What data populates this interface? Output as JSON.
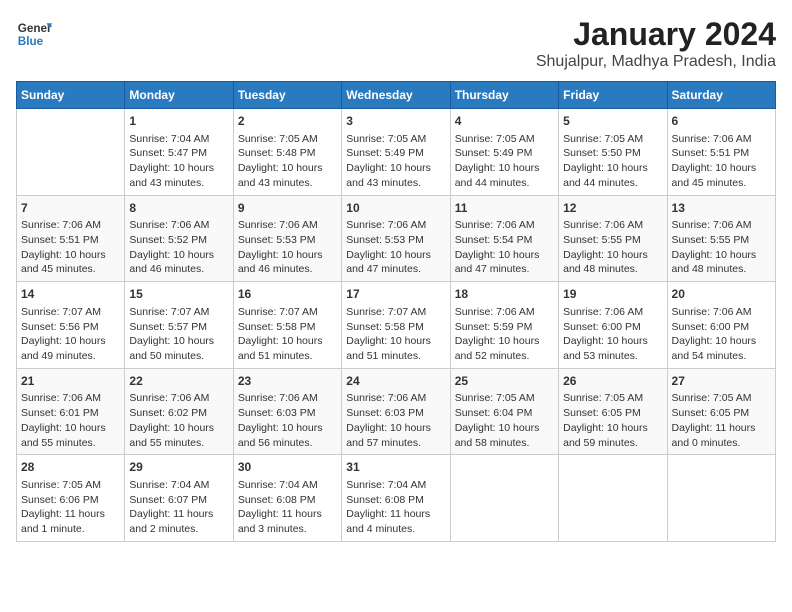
{
  "header": {
    "logo_line1": "General",
    "logo_line2": "Blue",
    "title": "January 2024",
    "subtitle": "Shujalpur, Madhya Pradesh, India"
  },
  "weekdays": [
    "Sunday",
    "Monday",
    "Tuesday",
    "Wednesday",
    "Thursday",
    "Friday",
    "Saturday"
  ],
  "weeks": [
    [
      {
        "day": "",
        "info": ""
      },
      {
        "day": "1",
        "info": "Sunrise: 7:04 AM\nSunset: 5:47 PM\nDaylight: 10 hours\nand 43 minutes."
      },
      {
        "day": "2",
        "info": "Sunrise: 7:05 AM\nSunset: 5:48 PM\nDaylight: 10 hours\nand 43 minutes."
      },
      {
        "day": "3",
        "info": "Sunrise: 7:05 AM\nSunset: 5:49 PM\nDaylight: 10 hours\nand 43 minutes."
      },
      {
        "day": "4",
        "info": "Sunrise: 7:05 AM\nSunset: 5:49 PM\nDaylight: 10 hours\nand 44 minutes."
      },
      {
        "day": "5",
        "info": "Sunrise: 7:05 AM\nSunset: 5:50 PM\nDaylight: 10 hours\nand 44 minutes."
      },
      {
        "day": "6",
        "info": "Sunrise: 7:06 AM\nSunset: 5:51 PM\nDaylight: 10 hours\nand 45 minutes."
      }
    ],
    [
      {
        "day": "7",
        "info": "Sunrise: 7:06 AM\nSunset: 5:51 PM\nDaylight: 10 hours\nand 45 minutes."
      },
      {
        "day": "8",
        "info": "Sunrise: 7:06 AM\nSunset: 5:52 PM\nDaylight: 10 hours\nand 46 minutes."
      },
      {
        "day": "9",
        "info": "Sunrise: 7:06 AM\nSunset: 5:53 PM\nDaylight: 10 hours\nand 46 minutes."
      },
      {
        "day": "10",
        "info": "Sunrise: 7:06 AM\nSunset: 5:53 PM\nDaylight: 10 hours\nand 47 minutes."
      },
      {
        "day": "11",
        "info": "Sunrise: 7:06 AM\nSunset: 5:54 PM\nDaylight: 10 hours\nand 47 minutes."
      },
      {
        "day": "12",
        "info": "Sunrise: 7:06 AM\nSunset: 5:55 PM\nDaylight: 10 hours\nand 48 minutes."
      },
      {
        "day": "13",
        "info": "Sunrise: 7:06 AM\nSunset: 5:55 PM\nDaylight: 10 hours\nand 48 minutes."
      }
    ],
    [
      {
        "day": "14",
        "info": "Sunrise: 7:07 AM\nSunset: 5:56 PM\nDaylight: 10 hours\nand 49 minutes."
      },
      {
        "day": "15",
        "info": "Sunrise: 7:07 AM\nSunset: 5:57 PM\nDaylight: 10 hours\nand 50 minutes."
      },
      {
        "day": "16",
        "info": "Sunrise: 7:07 AM\nSunset: 5:58 PM\nDaylight: 10 hours\nand 51 minutes."
      },
      {
        "day": "17",
        "info": "Sunrise: 7:07 AM\nSunset: 5:58 PM\nDaylight: 10 hours\nand 51 minutes."
      },
      {
        "day": "18",
        "info": "Sunrise: 7:06 AM\nSunset: 5:59 PM\nDaylight: 10 hours\nand 52 minutes."
      },
      {
        "day": "19",
        "info": "Sunrise: 7:06 AM\nSunset: 6:00 PM\nDaylight: 10 hours\nand 53 minutes."
      },
      {
        "day": "20",
        "info": "Sunrise: 7:06 AM\nSunset: 6:00 PM\nDaylight: 10 hours\nand 54 minutes."
      }
    ],
    [
      {
        "day": "21",
        "info": "Sunrise: 7:06 AM\nSunset: 6:01 PM\nDaylight: 10 hours\nand 55 minutes."
      },
      {
        "day": "22",
        "info": "Sunrise: 7:06 AM\nSunset: 6:02 PM\nDaylight: 10 hours\nand 55 minutes."
      },
      {
        "day": "23",
        "info": "Sunrise: 7:06 AM\nSunset: 6:03 PM\nDaylight: 10 hours\nand 56 minutes."
      },
      {
        "day": "24",
        "info": "Sunrise: 7:06 AM\nSunset: 6:03 PM\nDaylight: 10 hours\nand 57 minutes."
      },
      {
        "day": "25",
        "info": "Sunrise: 7:05 AM\nSunset: 6:04 PM\nDaylight: 10 hours\nand 58 minutes."
      },
      {
        "day": "26",
        "info": "Sunrise: 7:05 AM\nSunset: 6:05 PM\nDaylight: 10 hours\nand 59 minutes."
      },
      {
        "day": "27",
        "info": "Sunrise: 7:05 AM\nSunset: 6:05 PM\nDaylight: 11 hours\nand 0 minutes."
      }
    ],
    [
      {
        "day": "28",
        "info": "Sunrise: 7:05 AM\nSunset: 6:06 PM\nDaylight: 11 hours\nand 1 minute."
      },
      {
        "day": "29",
        "info": "Sunrise: 7:04 AM\nSunset: 6:07 PM\nDaylight: 11 hours\nand 2 minutes."
      },
      {
        "day": "30",
        "info": "Sunrise: 7:04 AM\nSunset: 6:08 PM\nDaylight: 11 hours\nand 3 minutes."
      },
      {
        "day": "31",
        "info": "Sunrise: 7:04 AM\nSunset: 6:08 PM\nDaylight: 11 hours\nand 4 minutes."
      },
      {
        "day": "",
        "info": ""
      },
      {
        "day": "",
        "info": ""
      },
      {
        "day": "",
        "info": ""
      }
    ]
  ]
}
